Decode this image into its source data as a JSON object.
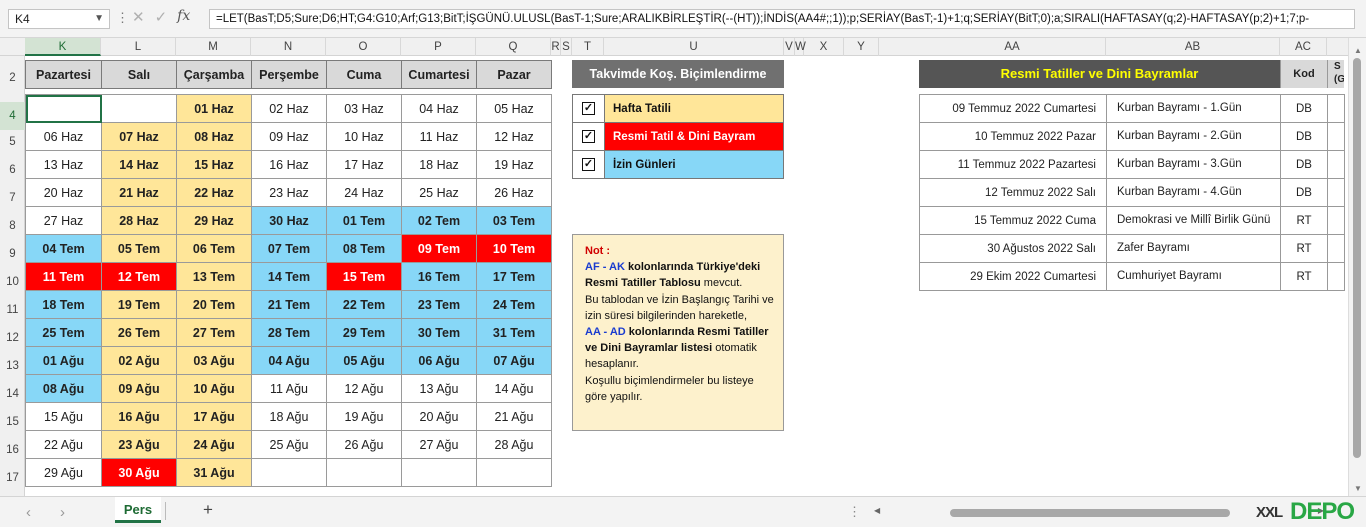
{
  "formula_bar": {
    "name_box": "K4",
    "fx_label": "fx",
    "formula": "=LET(BasT;D5;Sure;D6;HT;G4:G10;Arf;G13;BitT;İŞGÜNÜ.ULUSL(BasT-1;Sure;ARALIKBİRLEŞTİR(--(HT));İNDİS(AA4#;;1));p;SERİAY(BasT;-1)+1;q;SERİAY(BitT;0);a;SIRALI(HAFTASAY(q;2)-HAFTASAY(p;2)+1;7;p-"
  },
  "columns": [
    "K",
    "L",
    "M",
    "N",
    "O",
    "P",
    "Q",
    "R",
    "S",
    "T",
    "U",
    "V",
    "W",
    "X",
    "Y",
    "AA",
    "AB",
    "AC"
  ],
  "rows": [
    "2",
    "4",
    "5",
    "6",
    "7",
    "8",
    "9",
    "10",
    "11",
    "12",
    "13",
    "14",
    "15",
    "16",
    "17"
  ],
  "calendar": {
    "headers": [
      "Pazartesi",
      "Salı",
      "Çarşamba",
      "Perşembe",
      "Cuma",
      "Cumartesi",
      "Pazar"
    ],
    "weeks": [
      [
        {
          "t": "",
          "s": "plain"
        },
        {
          "t": "",
          "s": "plain"
        },
        {
          "t": "01 Haz",
          "s": "wk"
        },
        {
          "t": "02 Haz",
          "s": "plain"
        },
        {
          "t": "03 Haz",
          "s": "plain"
        },
        {
          "t": "04 Haz",
          "s": "plain"
        },
        {
          "t": "05 Haz",
          "s": "plain"
        }
      ],
      [
        {
          "t": "06 Haz",
          "s": "plain"
        },
        {
          "t": "07 Haz",
          "s": "wk"
        },
        {
          "t": "08 Haz",
          "s": "wk"
        },
        {
          "t": "09 Haz",
          "s": "plain"
        },
        {
          "t": "10 Haz",
          "s": "plain"
        },
        {
          "t": "11 Haz",
          "s": "plain"
        },
        {
          "t": "12 Haz",
          "s": "plain"
        }
      ],
      [
        {
          "t": "13 Haz",
          "s": "plain"
        },
        {
          "t": "14 Haz",
          "s": "wk"
        },
        {
          "t": "15 Haz",
          "s": "wk"
        },
        {
          "t": "16 Haz",
          "s": "plain"
        },
        {
          "t": "17 Haz",
          "s": "plain"
        },
        {
          "t": "18 Haz",
          "s": "plain"
        },
        {
          "t": "19 Haz",
          "s": "plain"
        }
      ],
      [
        {
          "t": "20 Haz",
          "s": "plain"
        },
        {
          "t": "21 Haz",
          "s": "wk"
        },
        {
          "t": "22 Haz",
          "s": "wk"
        },
        {
          "t": "23 Haz",
          "s": "plain"
        },
        {
          "t": "24 Haz",
          "s": "plain"
        },
        {
          "t": "25 Haz",
          "s": "plain"
        },
        {
          "t": "26 Haz",
          "s": "plain"
        }
      ],
      [
        {
          "t": "27 Haz",
          "s": "plain"
        },
        {
          "t": "28 Haz",
          "s": "wk"
        },
        {
          "t": "29 Haz",
          "s": "wk"
        },
        {
          "t": "30 Haz",
          "s": "le"
        },
        {
          "t": "01 Tem",
          "s": "le"
        },
        {
          "t": "02 Tem",
          "s": "le"
        },
        {
          "t": "03 Tem",
          "s": "le"
        }
      ],
      [
        {
          "t": "04 Tem",
          "s": "le"
        },
        {
          "t": "05 Tem",
          "s": "wk"
        },
        {
          "t": "06 Tem",
          "s": "wk"
        },
        {
          "t": "07 Tem",
          "s": "le"
        },
        {
          "t": "08 Tem",
          "s": "le"
        },
        {
          "t": "09 Tem",
          "s": "ho"
        },
        {
          "t": "10 Tem",
          "s": "ho"
        }
      ],
      [
        {
          "t": "11 Tem",
          "s": "ho"
        },
        {
          "t": "12 Tem",
          "s": "ho"
        },
        {
          "t": "13 Tem",
          "s": "wk"
        },
        {
          "t": "14 Tem",
          "s": "le"
        },
        {
          "t": "15 Tem",
          "s": "ho"
        },
        {
          "t": "16 Tem",
          "s": "le"
        },
        {
          "t": "17 Tem",
          "s": "le"
        }
      ],
      [
        {
          "t": "18 Tem",
          "s": "le"
        },
        {
          "t": "19 Tem",
          "s": "wk"
        },
        {
          "t": "20 Tem",
          "s": "wk"
        },
        {
          "t": "21 Tem",
          "s": "le"
        },
        {
          "t": "22 Tem",
          "s": "le"
        },
        {
          "t": "23 Tem",
          "s": "le"
        },
        {
          "t": "24 Tem",
          "s": "le"
        }
      ],
      [
        {
          "t": "25 Tem",
          "s": "le"
        },
        {
          "t": "26 Tem",
          "s": "wk"
        },
        {
          "t": "27 Tem",
          "s": "wk"
        },
        {
          "t": "28 Tem",
          "s": "le"
        },
        {
          "t": "29 Tem",
          "s": "le"
        },
        {
          "t": "30 Tem",
          "s": "le"
        },
        {
          "t": "31 Tem",
          "s": "le"
        }
      ],
      [
        {
          "t": "01 Ağu",
          "s": "le"
        },
        {
          "t": "02 Ağu",
          "s": "wk"
        },
        {
          "t": "03 Ağu",
          "s": "wk"
        },
        {
          "t": "04 Ağu",
          "s": "le"
        },
        {
          "t": "05 Ağu",
          "s": "le"
        },
        {
          "t": "06 Ağu",
          "s": "le"
        },
        {
          "t": "07 Ağu",
          "s": "le"
        }
      ],
      [
        {
          "t": "08 Ağu",
          "s": "le"
        },
        {
          "t": "09 Ağu",
          "s": "wk"
        },
        {
          "t": "10 Ağu",
          "s": "wk"
        },
        {
          "t": "11 Ağu",
          "s": "plain"
        },
        {
          "t": "12 Ağu",
          "s": "plain"
        },
        {
          "t": "13 Ağu",
          "s": "plain"
        },
        {
          "t": "14 Ağu",
          "s": "plain"
        }
      ],
      [
        {
          "t": "15 Ağu",
          "s": "plain"
        },
        {
          "t": "16 Ağu",
          "s": "wk"
        },
        {
          "t": "17 Ağu",
          "s": "wk"
        },
        {
          "t": "18 Ağu",
          "s": "plain"
        },
        {
          "t": "19 Ağu",
          "s": "plain"
        },
        {
          "t": "20 Ağu",
          "s": "plain"
        },
        {
          "t": "21 Ağu",
          "s": "plain"
        }
      ],
      [
        {
          "t": "22 Ağu",
          "s": "plain"
        },
        {
          "t": "23 Ağu",
          "s": "wk"
        },
        {
          "t": "24 Ağu",
          "s": "wk"
        },
        {
          "t": "25 Ağu",
          "s": "plain"
        },
        {
          "t": "26 Ağu",
          "s": "plain"
        },
        {
          "t": "27 Ağu",
          "s": "plain"
        },
        {
          "t": "28 Ağu",
          "s": "plain"
        }
      ],
      [
        {
          "t": "29 Ağu",
          "s": "plain"
        },
        {
          "t": "30 Ağu",
          "s": "ho"
        },
        {
          "t": "31 Ağu",
          "s": "wk"
        },
        {
          "t": "",
          "s": "plain"
        },
        {
          "t": "",
          "s": "plain"
        },
        {
          "t": "",
          "s": "plain"
        },
        {
          "t": "",
          "s": "plain"
        }
      ]
    ]
  },
  "legend": {
    "title": "Takvimde  Koş. Biçimlendirme",
    "items": [
      {
        "label": "Hafta Tatili",
        "color": "#ffe699",
        "text_color": "#111111"
      },
      {
        "label": "Resmi Tatil & Dini Bayram",
        "color": "#ff0000",
        "text_color": "#ffffff"
      },
      {
        "label": "İzin Günleri",
        "color": "#87d7f7",
        "text_color": "#111111"
      }
    ]
  },
  "note": {
    "title": "Not :",
    "p1_blue": "AF - AK",
    "p1_bold": "kolonlarında Türkiye'deki Resmi Tatiller Tablosu",
    "p1_rest": "mevcut.",
    "p2": "Bu tablodan ve İzin Başlangıç Tarihi ve izin süresi bilgilerinden hareketle,",
    "p3_blue": "AA - AD",
    "p3_bold": "kolonlarında Resmi Tatiller ve Dini Bayramlar listesi",
    "p3_rest": "otomatik hesaplanır.",
    "p4": "Koşullu biçimlendirmeler bu listeye göre yapılır."
  },
  "holidays": {
    "title": "Resmi Tatiller ve Dini Bayramlar",
    "kod_header": "Kod",
    "extra_header": "S (G",
    "rows": [
      {
        "date": "09 Temmuz 2022 Cumartesi",
        "name": "Kurban Bayramı - 1.Gün",
        "kod": "DB"
      },
      {
        "date": "10 Temmuz 2022 Pazar",
        "name": "Kurban Bayramı - 2.Gün",
        "kod": "DB"
      },
      {
        "date": "11 Temmuz 2022 Pazartesi",
        "name": "Kurban Bayramı - 3.Gün",
        "kod": "DB"
      },
      {
        "date": "12 Temmuz 2022 Salı",
        "name": "Kurban Bayramı - 4.Gün",
        "kod": "DB"
      },
      {
        "date": "15 Temmuz 2022 Cuma",
        "name": "Demokrasi ve Millî Birlik Günü",
        "kod": "RT"
      },
      {
        "date": "30 Ağustos 2022 Salı",
        "name": "Zafer Bayramı",
        "kod": "RT"
      },
      {
        "date": "29 Ekim 2022 Cumartesi",
        "name": "Cumhuriyet Bayramı",
        "kod": "RT"
      }
    ]
  },
  "sheet_tabs": {
    "active": "Pers",
    "add": "+"
  },
  "watermark": {
    "part1": "XXL",
    "part2": "DEPO"
  }
}
